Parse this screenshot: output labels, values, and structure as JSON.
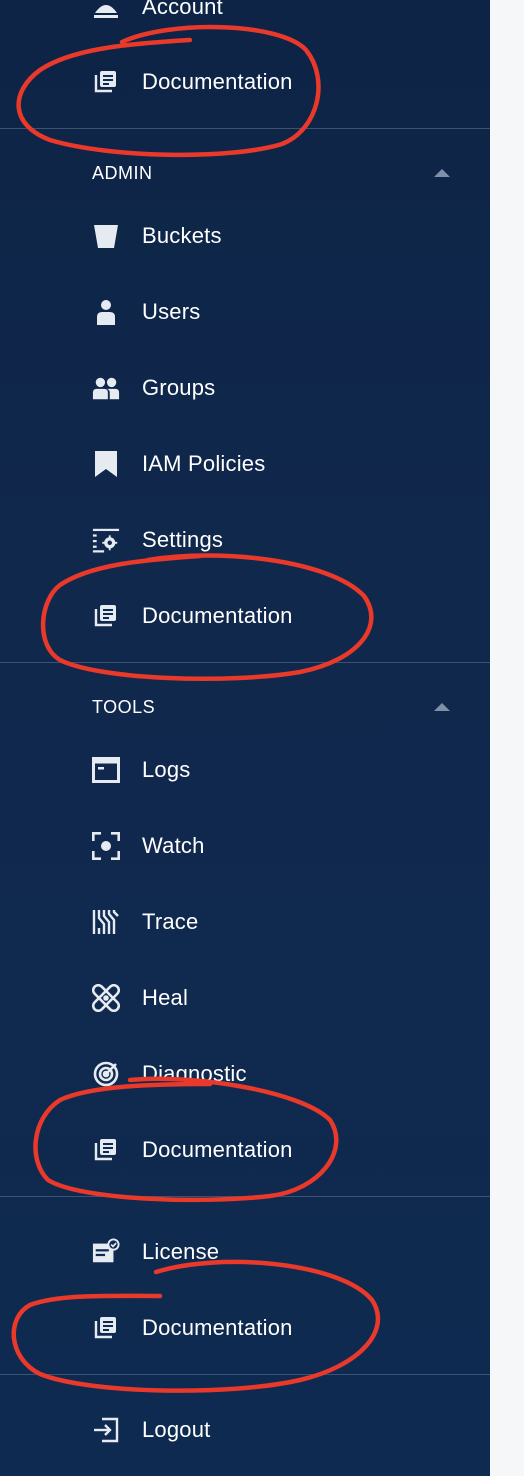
{
  "menu": {
    "account": "Account",
    "doc1": "Documentation",
    "admin_header": "ADMIN",
    "buckets": "Buckets",
    "users": "Users",
    "groups": "Groups",
    "iam_policies": "IAM Policies",
    "settings": "Settings",
    "doc2": "Documentation",
    "tools_header": "TOOLS",
    "logs": "Logs",
    "watch": "Watch",
    "trace": "Trace",
    "heal": "Heal",
    "diagnostic": "Diagnostic",
    "doc3": "Documentation",
    "license": "License",
    "doc4": "Documentation",
    "logout": "Logout"
  },
  "colors": {
    "sidebar_bg": "#0f2a50",
    "text": "#ffffff",
    "icon": "#e6ebf2",
    "annotation": "#e8392a"
  }
}
